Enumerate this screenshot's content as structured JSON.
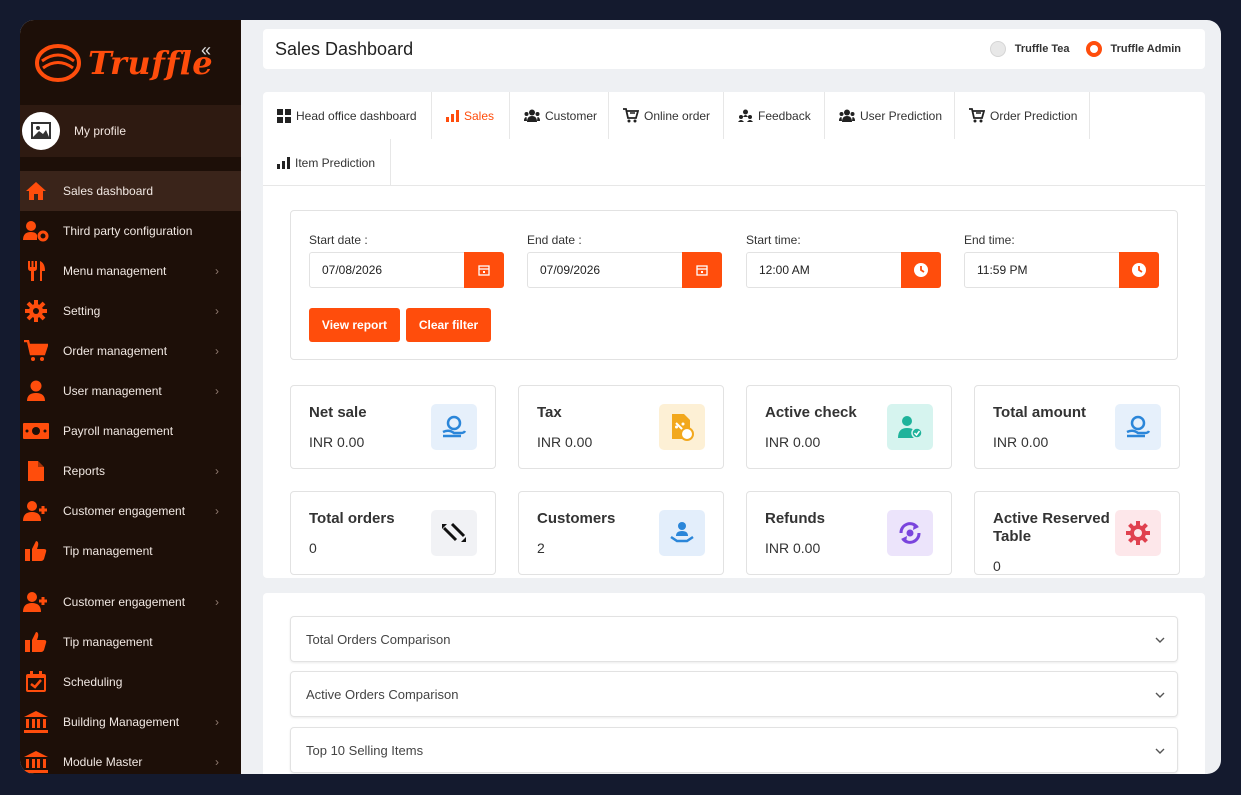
{
  "brand": {
    "name": "Truffle",
    "accent": "#ff4d0c",
    "sidebar_bg": "#1d0f08"
  },
  "sidebar": {
    "collapse_icon": "double-chevron-left-icon",
    "profile": {
      "label": "My profile",
      "icon": "image-placeholder-icon"
    },
    "items": [
      {
        "label": "Sales dashboard",
        "icon": "home-icon",
        "chevron": false,
        "active": true
      },
      {
        "label": "Third party configuration",
        "icon": "users-cog-icon",
        "chevron": false
      },
      {
        "label": "Menu management",
        "icon": "utensils-icon",
        "chevron": true
      },
      {
        "label": "Setting",
        "icon": "gear-icon",
        "chevron": true
      },
      {
        "label": "Order management",
        "icon": "cart-icon",
        "chevron": true
      },
      {
        "label": "User management",
        "icon": "user-icon",
        "chevron": true
      },
      {
        "label": "Payroll management",
        "icon": "money-bill-icon",
        "chevron": false
      },
      {
        "label": "Reports",
        "icon": "file-icon",
        "chevron": true
      },
      {
        "label": "Customer engagement",
        "icon": "user-plus-icon",
        "chevron": true
      },
      {
        "label": "Tip management",
        "icon": "thumbs-up-icon",
        "chevron": false
      },
      {
        "label": "Customer engagement",
        "icon": "user-plus-icon",
        "chevron": true
      },
      {
        "label": "Tip management",
        "icon": "thumbs-up-icon",
        "chevron": false
      },
      {
        "label": "Scheduling",
        "icon": "calendar-check-icon",
        "chevron": false
      },
      {
        "label": "Building Management",
        "icon": "building-columns-icon",
        "chevron": true
      },
      {
        "label": "Module Master",
        "icon": "building-columns-icon",
        "chevron": true
      }
    ]
  },
  "header": {
    "title": "Sales Dashboard",
    "shops": [
      {
        "label": "Truffle Tea",
        "selected": false
      },
      {
        "label": "Truffle Admin",
        "selected": true
      }
    ]
  },
  "tabs": [
    {
      "label": "Head office dashboard",
      "icon": "grid-icon"
    },
    {
      "label": "Sales",
      "icon": "bar-chart-icon",
      "active": true
    },
    {
      "label": "Customer",
      "icon": "users-icon"
    },
    {
      "label": "Online order",
      "icon": "online-cart-icon"
    },
    {
      "label": "Feedback",
      "icon": "people-group-icon"
    },
    {
      "label": "User Prediction",
      "icon": "users-icon"
    },
    {
      "label": "Order Prediction",
      "icon": "online-cart-icon"
    },
    {
      "label": "Item Prediction",
      "icon": "bar-chart-icon"
    }
  ],
  "filters": {
    "start_date": {
      "label": "Start date :",
      "value": "07/08/2026",
      "icon": "calendar-icon"
    },
    "end_date": {
      "label": "End date :",
      "value": "07/09/2026",
      "icon": "calendar-icon"
    },
    "start_time": {
      "label": "Start time:",
      "value": "12:00 AM",
      "icon": "clock-icon"
    },
    "end_time": {
      "label": "End time:",
      "value": "11:59 PM",
      "icon": "clock-icon"
    },
    "view_report": "View report",
    "clear_filter": "Clear filter"
  },
  "stats": [
    {
      "title": "Net sale",
      "value": "INR 0.00",
      "icon": "hand-coin-icon",
      "icon_bg": "#e6f0fb",
      "icon_color": "#2b86d9"
    },
    {
      "title": "Tax",
      "value": "INR 0.00",
      "icon": "tax-document-icon",
      "icon_bg": "#fdf0d5",
      "icon_color": "#f2a81d"
    },
    {
      "title": "Active check",
      "value": "INR 0.00",
      "icon": "user-check-icon",
      "icon_bg": "#d6f4ef",
      "icon_color": "#1fb39b"
    },
    {
      "title": "Total amount",
      "value": "INR 0.00",
      "icon": "hand-coin-icon",
      "icon_bg": "#e6f0fb",
      "icon_color": "#2b86d9"
    },
    {
      "title": "Total orders",
      "value": "0",
      "icon": "exchange-icon",
      "icon_bg": "#f1f2f5",
      "icon_color": "#111111"
    },
    {
      "title": "Customers",
      "value": "2",
      "icon": "customer-hand-icon",
      "icon_bg": "#e3eefb",
      "icon_color": "#2b86d9"
    },
    {
      "title": "Refunds",
      "value": "INR 0.00",
      "icon": "refund-icon",
      "icon_bg": "#ece4fb",
      "icon_color": "#7a44dd"
    },
    {
      "title": "Active Reserved Table",
      "value": "0",
      "icon": "gear-badge-icon",
      "icon_bg": "#fde7ea",
      "icon_color": "#e0414f"
    }
  ],
  "accordions": [
    {
      "title": "Total Orders Comparison"
    },
    {
      "title": "Active Orders Comparison"
    },
    {
      "title": "Top 10 Selling Items"
    }
  ]
}
